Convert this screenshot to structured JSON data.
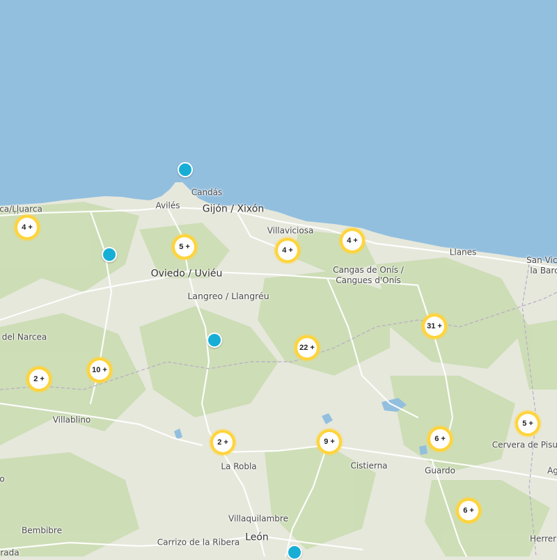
{
  "colors": {
    "sea": "#93bfdf",
    "land": "#e6e8dc",
    "vegetation": "#c8dbaf",
    "cluster_ring": "#ffd43b",
    "marker": "#17aed6"
  },
  "places": [
    {
      "id": "candas",
      "label": "Candás"
    },
    {
      "id": "aviles",
      "label": "Avilés"
    },
    {
      "id": "gijon",
      "label": "Gijón / Xixón"
    },
    {
      "id": "luarca",
      "label": "ca/Ļļuarca"
    },
    {
      "id": "villaviciosa",
      "label": "Villaviciosa"
    },
    {
      "id": "llanes",
      "label": "Llanes"
    },
    {
      "id": "san-vicente",
      "label": "San Vice\nla Barc"
    },
    {
      "id": "oviedo",
      "label": "Oviedo / Uviéu"
    },
    {
      "id": "cangas-onis",
      "label": "Cangas de Onís /\nCangues d'Onís"
    },
    {
      "id": "langreo",
      "label": "Langreo / Llangréu"
    },
    {
      "id": "cangas-narcea",
      "label": "del Narcea"
    },
    {
      "id": "villablino",
      "label": "Villablino"
    },
    {
      "id": "la-robla",
      "label": "La Robla"
    },
    {
      "id": "cistierna",
      "label": "Cistierna"
    },
    {
      "id": "guardo",
      "label": "Guardo"
    },
    {
      "id": "cervera",
      "label": "Cervera de Pisuer"
    },
    {
      "id": "villaquilambre",
      "label": "Villaquilambre"
    },
    {
      "id": "bembibre",
      "label": "Bembibre"
    },
    {
      "id": "carrizo",
      "label": "Carrizo de la Ribera"
    },
    {
      "id": "leon",
      "label": "León"
    },
    {
      "id": "herrera",
      "label": "Herrer"
    },
    {
      "id": "edge-o",
      "label": "o"
    },
    {
      "id": "edge-ag",
      "label": "Ag"
    },
    {
      "id": "edge-rada",
      "label": "rada"
    }
  ],
  "clusters": [
    {
      "id": "c-west-coast",
      "label": "4 +"
    },
    {
      "id": "c-oviedo-north",
      "label": "5 +"
    },
    {
      "id": "c-villaviciosa",
      "label": "4 +"
    },
    {
      "id": "c-ribadesella",
      "label": "4 +"
    },
    {
      "id": "c-picos",
      "label": "31 +"
    },
    {
      "id": "c-riano",
      "label": "22 +"
    },
    {
      "id": "c-narcea",
      "label": "2 +"
    },
    {
      "id": "c-somiedo",
      "label": "10 +"
    },
    {
      "id": "c-la-robla",
      "label": "2 +"
    },
    {
      "id": "c-cistierna",
      "label": "9 +"
    },
    {
      "id": "c-guardo",
      "label": "6 +"
    },
    {
      "id": "c-cervera",
      "label": "5 +"
    },
    {
      "id": "c-saldana",
      "label": "6 +"
    }
  ],
  "markers": [
    {
      "id": "m-cabo-penas"
    },
    {
      "id": "m-grado"
    },
    {
      "id": "m-pola-lena"
    },
    {
      "id": "m-leon"
    }
  ]
}
